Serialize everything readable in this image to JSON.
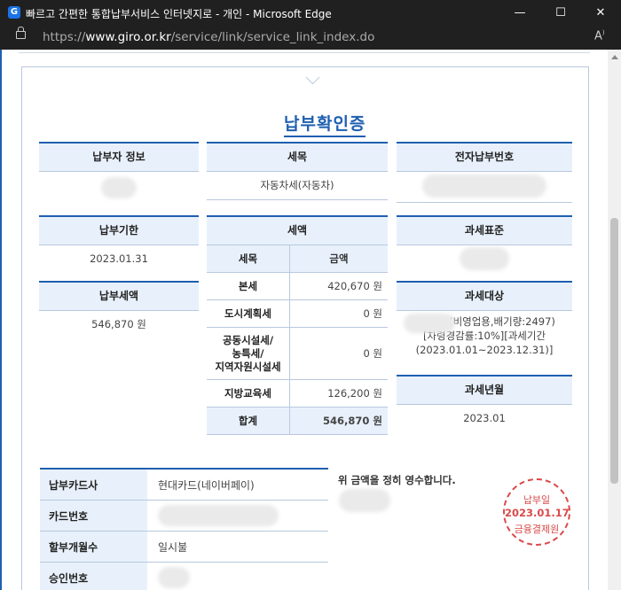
{
  "window": {
    "title": "빠르고 간편한 통합납부서비스 인터넷지로 - 개인 - Microsoft Edge",
    "url_prefix": "https://",
    "url_host": "www.giro.or.kr",
    "url_path": "/service/link/service_link_index.do"
  },
  "document": {
    "title": "납부확인증",
    "payer_info": {
      "label": "납부자 정보"
    },
    "tax_item": {
      "label": "세목",
      "value": "자동차세(자동차)"
    },
    "electronic_no": {
      "label": "전자납부번호"
    },
    "due_date": {
      "label": "납부기한",
      "value": "2023.01.31"
    },
    "paid_amount": {
      "label": "납부세액",
      "value": "546,870 원"
    },
    "tax_amount": {
      "label": "세액",
      "col_item": "세목",
      "col_amount": "금액",
      "rows": [
        {
          "item": "본세",
          "amount": "420,670 원"
        },
        {
          "item": "도시계획세",
          "amount": "0 원"
        },
        {
          "item": "공동시설세/\n농특세/\n지역자원시설세",
          "amount": "0 원"
        },
        {
          "item": "지방교육세",
          "amount": "126,200 원"
        }
      ],
      "total_label": "합계",
      "total_value": "546,870 원"
    },
    "tax_standard": {
      "label": "과세표준"
    },
    "tax_object": {
      "label": "과세대상",
      "line1": "(비영업용,배기량:2497)",
      "line2": "[차령경감률:10%][과세기간",
      "line3": "(2023.01.01~2023.12.31)]"
    },
    "tax_year_month": {
      "label": "과세년월",
      "value": "2023.01"
    },
    "card": {
      "company_label": "납부카드사",
      "company_value": "현대카드(네이버페이)",
      "number_label": "카드번호",
      "installment_label": "할부개월수",
      "installment_value": "일시불",
      "approval_label": "승인번호"
    },
    "receipt_text": "위 금액을 정히 영수합니다.",
    "stamp": {
      "line1": "납부일",
      "date": "2023.01.17",
      "line3": "금융결제원",
      "color": "#d94a4a"
    }
  },
  "colors": {
    "accent": "#1f5fb0",
    "header_bg": "#e8f1fb",
    "titlebar": "#202020"
  },
  "icons": [
    "lock-icon",
    "read-aloud-icon",
    "minimize-icon",
    "maximize-icon",
    "close-icon"
  ]
}
